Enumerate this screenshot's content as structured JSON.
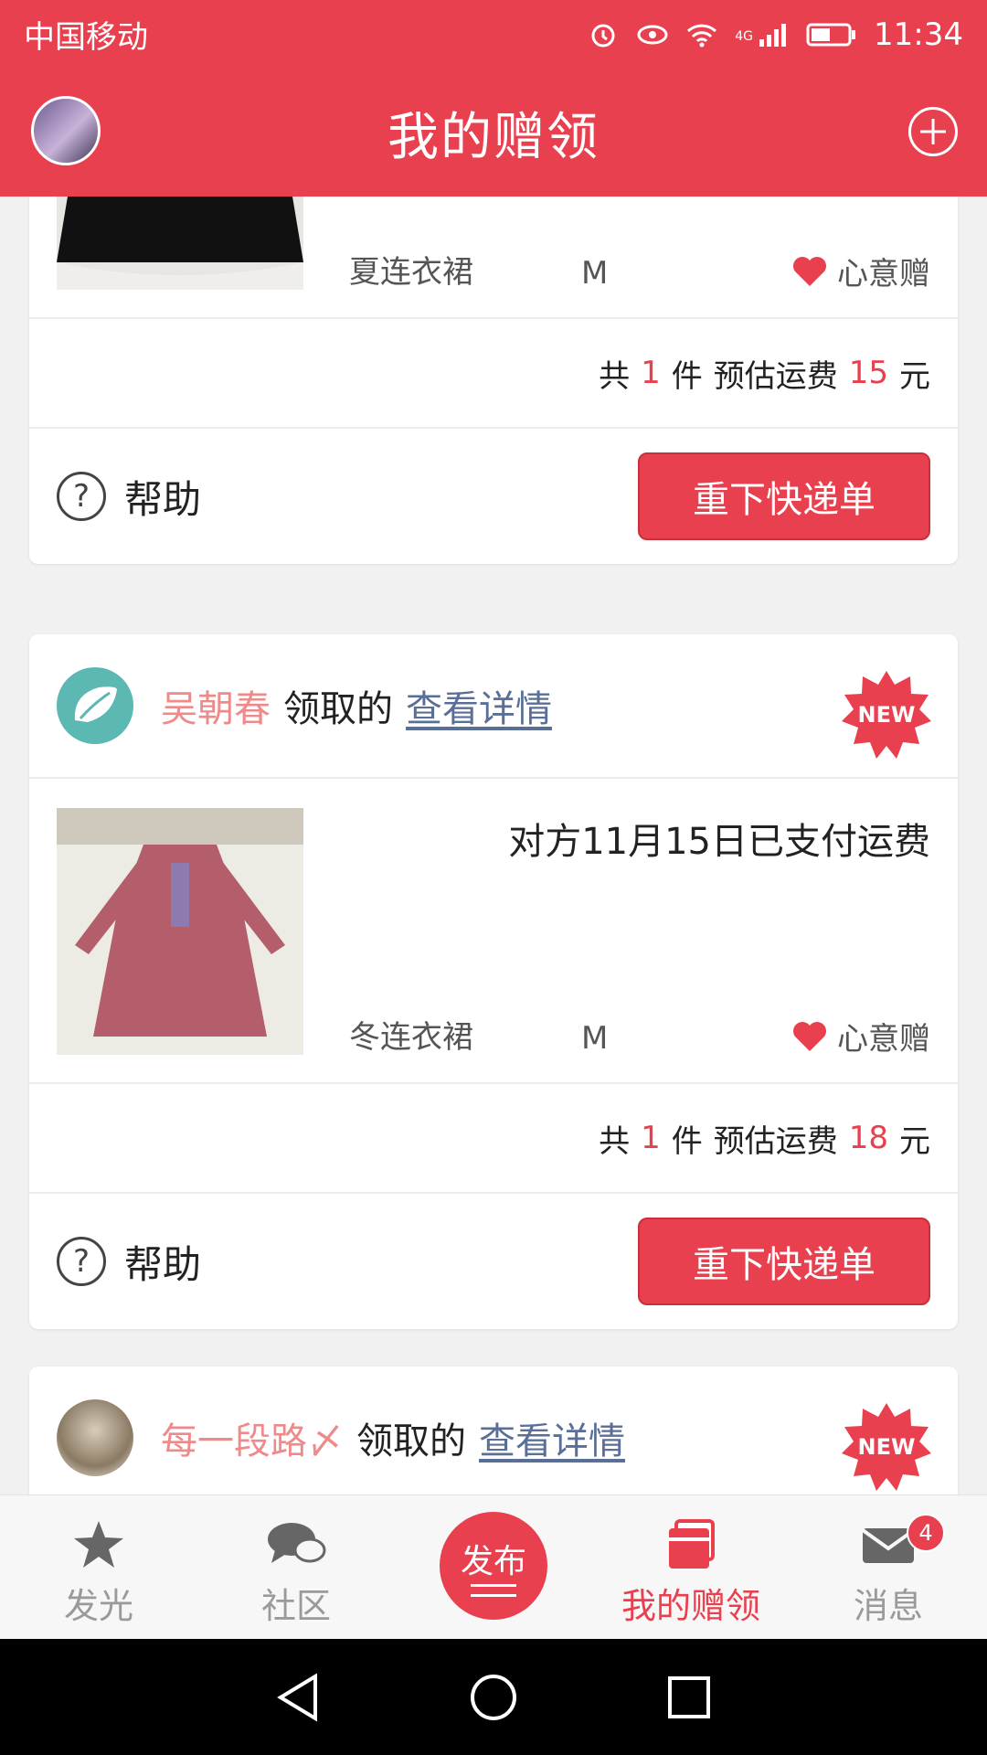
{
  "status_bar": {
    "carrier": "中国移动",
    "network": "4G",
    "time": "11:34"
  },
  "header": {
    "title": "我的赠领"
  },
  "cards": [
    {
      "item": {
        "name": "夏连衣裙",
        "size": "M",
        "gift_type": "心意赠"
      },
      "summary": {
        "prefix": "共",
        "count": "1",
        "count_unit": "件",
        "fee_label": "预估运费",
        "fee": "15",
        "fee_unit": "元"
      },
      "actions": {
        "help_label": "帮助",
        "reorder_label": "重下快递单"
      }
    },
    {
      "head": {
        "name": "吴朝春",
        "action": "领取的",
        "link": "查看详情",
        "badge": "NEW"
      },
      "item": {
        "status": "对方11月15日已支付运费",
        "name": "冬连衣裙",
        "size": "M",
        "gift_type": "心意赠"
      },
      "summary": {
        "prefix": "共",
        "count": "1",
        "count_unit": "件",
        "fee_label": "预估运费",
        "fee": "18",
        "fee_unit": "元"
      },
      "actions": {
        "help_label": "帮助",
        "reorder_label": "重下快递单"
      }
    },
    {
      "head": {
        "name": "每一段路〆",
        "action": "领取的",
        "link": "查看详情",
        "badge": "NEW"
      }
    }
  ],
  "bottom_nav": {
    "items": [
      {
        "label": "发光",
        "icon": "star-icon"
      },
      {
        "label": "社区",
        "icon": "chat-bubbles-icon"
      },
      {
        "label": "发布",
        "icon": "publish-icon"
      },
      {
        "label": "我的赠领",
        "icon": "gift-box-icon",
        "active": true
      },
      {
        "label": "消息",
        "icon": "mail-icon",
        "badge": "4"
      }
    ]
  },
  "colors": {
    "brand": "#e8404f",
    "link": "#5a6f97",
    "name": "#ee8a8a"
  }
}
